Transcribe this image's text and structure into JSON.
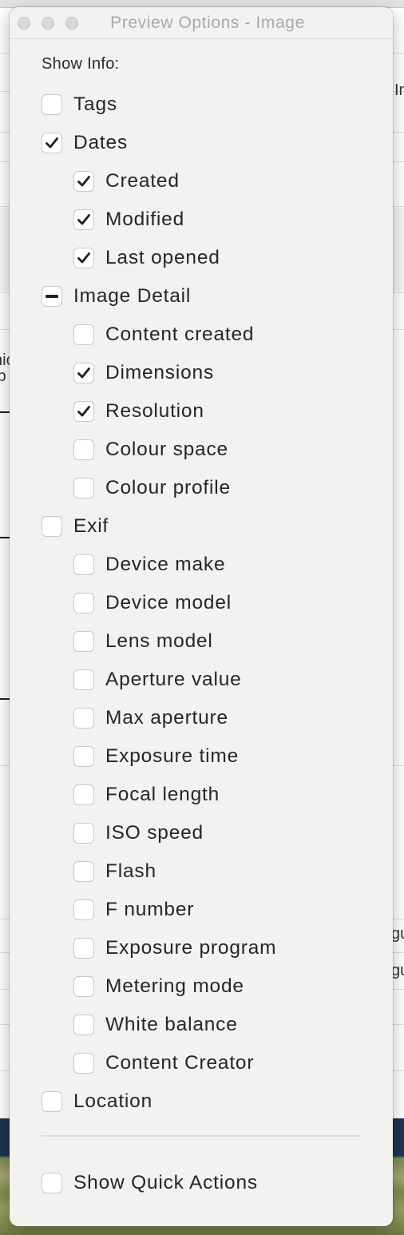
{
  "window": {
    "title": "Preview Options - Image",
    "buttons": [
      "close",
      "minimize",
      "zoom"
    ]
  },
  "section_label": "Show Info:",
  "options": [
    {
      "label": "Tags",
      "state": "unchecked",
      "level": 0
    },
    {
      "label": "Dates",
      "state": "checked",
      "level": 0
    },
    {
      "label": "Created",
      "state": "checked",
      "level": 1
    },
    {
      "label": "Modified",
      "state": "checked",
      "level": 1
    },
    {
      "label": "Last opened",
      "state": "checked",
      "level": 1
    },
    {
      "label": "Image Detail",
      "state": "mixed",
      "level": 0
    },
    {
      "label": "Content created",
      "state": "unchecked",
      "level": 1
    },
    {
      "label": "Dimensions",
      "state": "checked",
      "level": 1
    },
    {
      "label": "Resolution",
      "state": "checked",
      "level": 1
    },
    {
      "label": "Colour space",
      "state": "unchecked",
      "level": 1
    },
    {
      "label": "Colour profile",
      "state": "unchecked",
      "level": 1
    },
    {
      "label": "Exif",
      "state": "unchecked",
      "level": 0
    },
    {
      "label": "Device make",
      "state": "unchecked",
      "level": 1
    },
    {
      "label": "Device model",
      "state": "unchecked",
      "level": 1
    },
    {
      "label": "Lens model",
      "state": "unchecked",
      "level": 1
    },
    {
      "label": "Aperture value",
      "state": "unchecked",
      "level": 1
    },
    {
      "label": "Max aperture",
      "state": "unchecked",
      "level": 1
    },
    {
      "label": "Exposure time",
      "state": "unchecked",
      "level": 1
    },
    {
      "label": "Focal length",
      "state": "unchecked",
      "level": 1
    },
    {
      "label": "ISO speed",
      "state": "unchecked",
      "level": 1
    },
    {
      "label": "Flash",
      "state": "unchecked",
      "level": 1
    },
    {
      "label": "F number",
      "state": "unchecked",
      "level": 1
    },
    {
      "label": "Exposure program",
      "state": "unchecked",
      "level": 1
    },
    {
      "label": "Metering mode",
      "state": "unchecked",
      "level": 1
    },
    {
      "label": "White balance",
      "state": "unchecked",
      "level": 1
    },
    {
      "label": "Content Creator",
      "state": "unchecked",
      "level": 1
    },
    {
      "label": "Location",
      "state": "unchecked",
      "level": 0
    }
  ],
  "quick_actions": {
    "label": "Show Quick Actions",
    "state": "unchecked"
  },
  "background_fragments": {
    "right_1": "In",
    "left_1": "nic",
    "left_2": "ip",
    "right_2": "gu",
    "right_3": "gu"
  },
  "colors": {
    "panel_bg": "#f2f2f1",
    "checkbox_border": "#c8c8c8",
    "text": "#262626",
    "title_text": "#a9a9a9"
  }
}
